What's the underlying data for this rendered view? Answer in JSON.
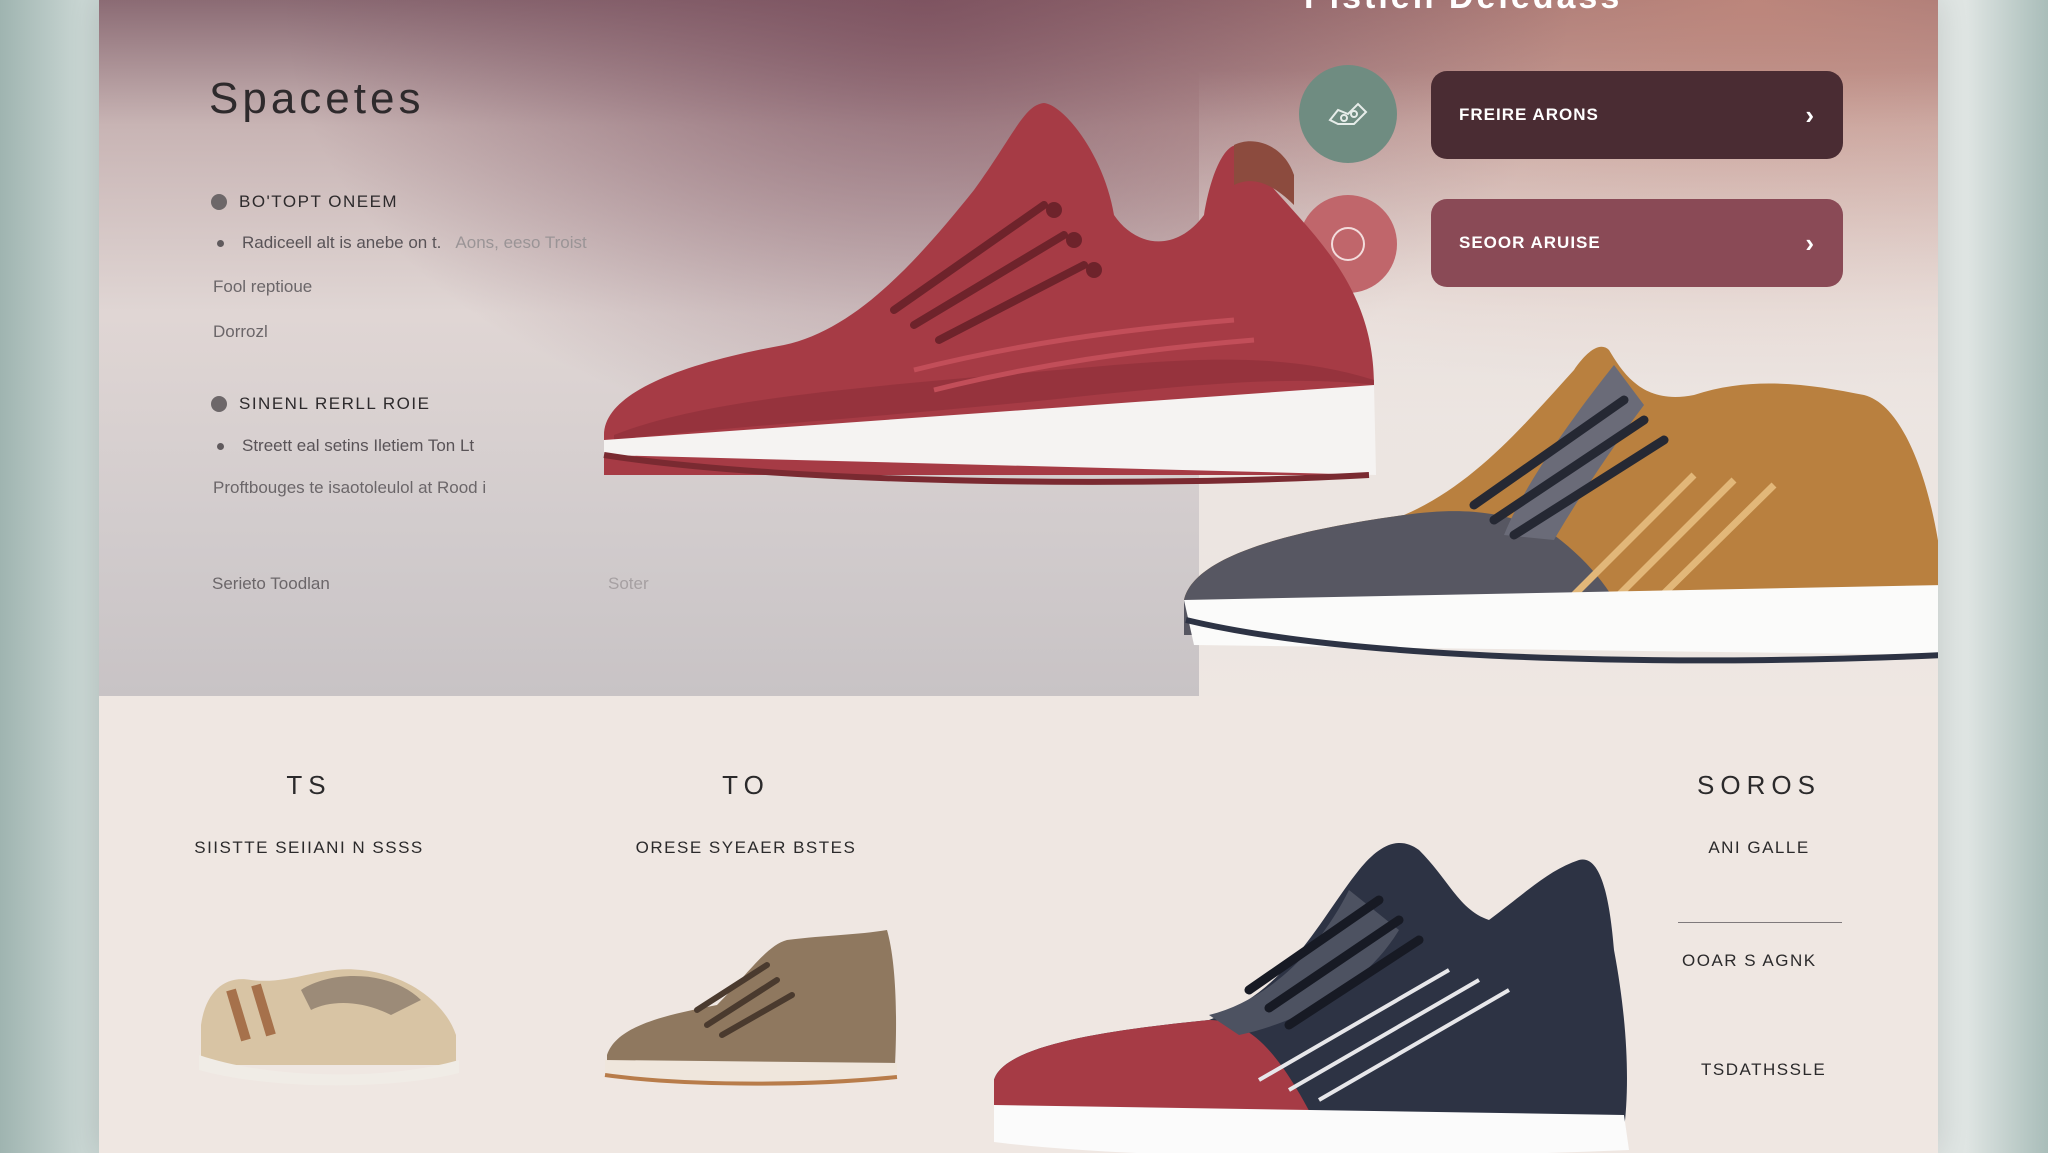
{
  "hero": {
    "top_title": "Pistien Deledass",
    "brand": "Spacetes",
    "section1": {
      "heading": "BO'TOPT ONEEM",
      "bullet": "Radiceell alt is anebe on t.",
      "bullet_faint": "Aons, eeso   Troist",
      "line1": "Fool reptioue",
      "line2": "Dorrozl"
    },
    "section2": {
      "heading": "SINENL RERLL ROIE",
      "bullet": "Streett eal setins Iletiem  Ton Lt",
      "line1": "Proftbouges te isaotoleulol at  Rood i"
    },
    "footer_left": "Serieto Toodlan",
    "footer_right": "Soter"
  },
  "actions": [
    {
      "label": "FREIRE ARONS",
      "icon": "shoe-outline-icon",
      "color": "#4a2c33",
      "circle": "#6f8c81"
    },
    {
      "label": "SEOOR ARUISE",
      "icon": "ring-icon",
      "color": "#8a4a56",
      "circle": "#c0666b"
    }
  ],
  "columns": [
    {
      "head": "TS",
      "sub": "SIISTTE SEIIANI N SSSS"
    },
    {
      "head": "TO",
      "sub": "ORESE SYEAER BSTES"
    },
    {
      "head": "SOROS",
      "sub": "ANI GALLE"
    }
  ],
  "side_items": [
    "OOAR S AGNK",
    "TSDATHSSLE"
  ],
  "colors": {
    "accent_dark": "#4a2c33",
    "accent_rose": "#8a4a56",
    "shoe_red": "#a63b45",
    "shoe_navy": "#2d3344",
    "shoe_tan": "#b9803f"
  }
}
